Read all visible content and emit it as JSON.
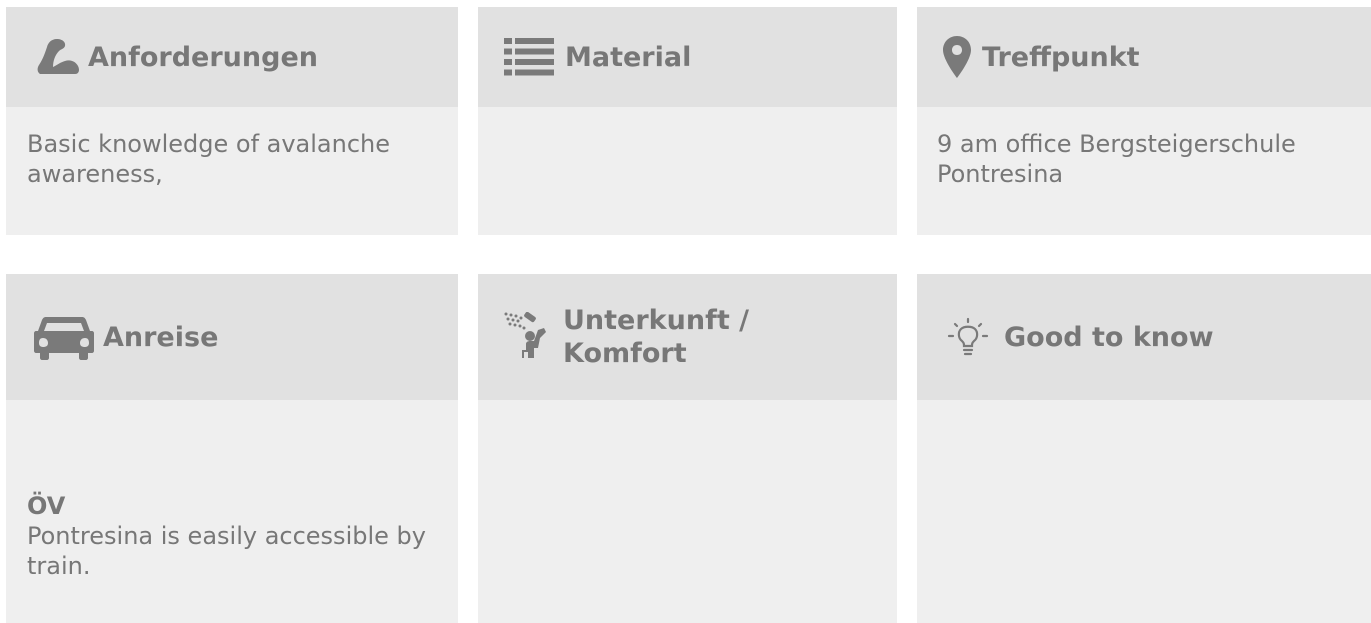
{
  "cards": [
    {
      "title": "Anforderungen",
      "icon": "flexed-arm-icon",
      "body": "Basic knowledge of avalanche awareness,"
    },
    {
      "title": "Material",
      "icon": "list-icon",
      "body": ""
    },
    {
      "title": "Treffpunkt",
      "icon": "map-marker-icon",
      "body": "9 am office Bergsteigerschule Pontresina"
    },
    {
      "title": "Anreise",
      "icon": "car-icon",
      "subheading": "ÖV",
      "body": "Pontresina is easily accessible by train."
    },
    {
      "title_line1": "Unterkunft /",
      "title_line2": "Komfort",
      "icon": "shower-icon",
      "body": ""
    },
    {
      "title": "Good to know",
      "icon": "lightbulb-icon",
      "body": ""
    }
  ],
  "colors": {
    "header_bg": "#e1e1e1",
    "body_bg": "#efefef",
    "text": "#777777",
    "icon": "#7a7a7a"
  }
}
